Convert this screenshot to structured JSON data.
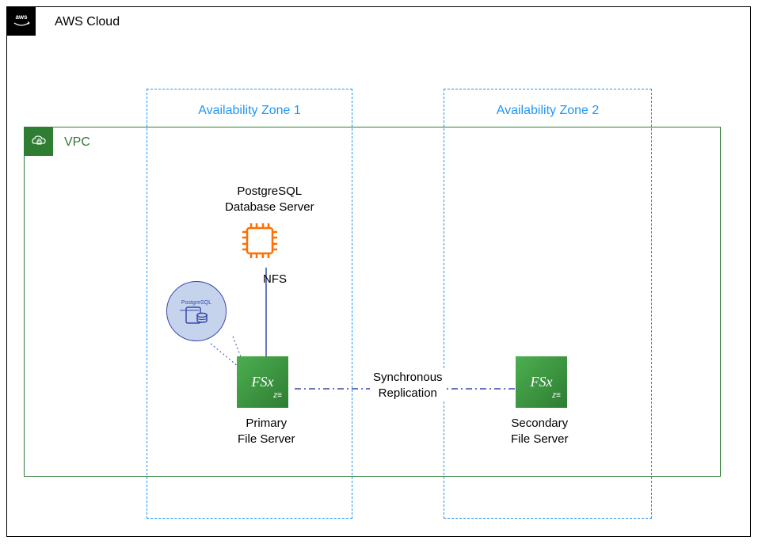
{
  "cloud": {
    "label": "AWS Cloud",
    "logo_text": "aws"
  },
  "vpc": {
    "label": "VPC"
  },
  "zones": {
    "az1": "Availability Zone 1",
    "az2": "Availability Zone 2"
  },
  "database": {
    "label_line1": "PostgreSQL",
    "label_line2": "Database Server",
    "connector_label": "NFS",
    "circle_label": "PostgreSQL"
  },
  "fileservers": {
    "icon_text": "FSx",
    "icon_sub": "z≡",
    "primary_line1": "Primary",
    "primary_line2": "File Server",
    "secondary_line1": "Secondary",
    "secondary_line2": "File Server"
  },
  "replication": {
    "line1": "Synchronous",
    "line2": "Replication"
  }
}
